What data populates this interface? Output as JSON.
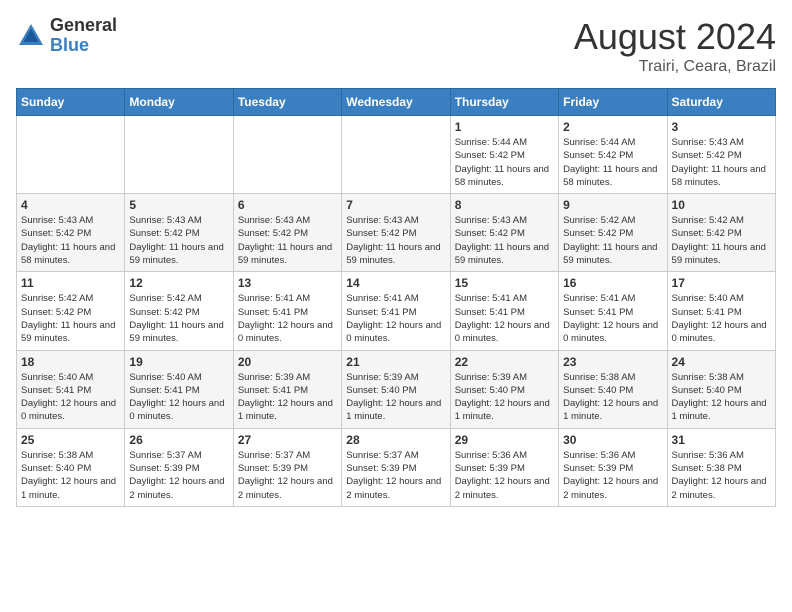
{
  "logo": {
    "general": "General",
    "blue": "Blue"
  },
  "header": {
    "month": "August 2024",
    "location": "Trairi, Ceara, Brazil"
  },
  "weekdays": [
    "Sunday",
    "Monday",
    "Tuesday",
    "Wednesday",
    "Thursday",
    "Friday",
    "Saturday"
  ],
  "weeks": [
    [
      {
        "day": "",
        "info": ""
      },
      {
        "day": "",
        "info": ""
      },
      {
        "day": "",
        "info": ""
      },
      {
        "day": "",
        "info": ""
      },
      {
        "day": "1",
        "info": "Sunrise: 5:44 AM\nSunset: 5:42 PM\nDaylight: 11 hours and 58 minutes."
      },
      {
        "day": "2",
        "info": "Sunrise: 5:44 AM\nSunset: 5:42 PM\nDaylight: 11 hours and 58 minutes."
      },
      {
        "day": "3",
        "info": "Sunrise: 5:43 AM\nSunset: 5:42 PM\nDaylight: 11 hours and 58 minutes."
      }
    ],
    [
      {
        "day": "4",
        "info": "Sunrise: 5:43 AM\nSunset: 5:42 PM\nDaylight: 11 hours and 58 minutes."
      },
      {
        "day": "5",
        "info": "Sunrise: 5:43 AM\nSunset: 5:42 PM\nDaylight: 11 hours and 59 minutes."
      },
      {
        "day": "6",
        "info": "Sunrise: 5:43 AM\nSunset: 5:42 PM\nDaylight: 11 hours and 59 minutes."
      },
      {
        "day": "7",
        "info": "Sunrise: 5:43 AM\nSunset: 5:42 PM\nDaylight: 11 hours and 59 minutes."
      },
      {
        "day": "8",
        "info": "Sunrise: 5:43 AM\nSunset: 5:42 PM\nDaylight: 11 hours and 59 minutes."
      },
      {
        "day": "9",
        "info": "Sunrise: 5:42 AM\nSunset: 5:42 PM\nDaylight: 11 hours and 59 minutes."
      },
      {
        "day": "10",
        "info": "Sunrise: 5:42 AM\nSunset: 5:42 PM\nDaylight: 11 hours and 59 minutes."
      }
    ],
    [
      {
        "day": "11",
        "info": "Sunrise: 5:42 AM\nSunset: 5:42 PM\nDaylight: 11 hours and 59 minutes."
      },
      {
        "day": "12",
        "info": "Sunrise: 5:42 AM\nSunset: 5:42 PM\nDaylight: 11 hours and 59 minutes."
      },
      {
        "day": "13",
        "info": "Sunrise: 5:41 AM\nSunset: 5:41 PM\nDaylight: 12 hours and 0 minutes."
      },
      {
        "day": "14",
        "info": "Sunrise: 5:41 AM\nSunset: 5:41 PM\nDaylight: 12 hours and 0 minutes."
      },
      {
        "day": "15",
        "info": "Sunrise: 5:41 AM\nSunset: 5:41 PM\nDaylight: 12 hours and 0 minutes."
      },
      {
        "day": "16",
        "info": "Sunrise: 5:41 AM\nSunset: 5:41 PM\nDaylight: 12 hours and 0 minutes."
      },
      {
        "day": "17",
        "info": "Sunrise: 5:40 AM\nSunset: 5:41 PM\nDaylight: 12 hours and 0 minutes."
      }
    ],
    [
      {
        "day": "18",
        "info": "Sunrise: 5:40 AM\nSunset: 5:41 PM\nDaylight: 12 hours and 0 minutes."
      },
      {
        "day": "19",
        "info": "Sunrise: 5:40 AM\nSunset: 5:41 PM\nDaylight: 12 hours and 0 minutes."
      },
      {
        "day": "20",
        "info": "Sunrise: 5:39 AM\nSunset: 5:41 PM\nDaylight: 12 hours and 1 minute."
      },
      {
        "day": "21",
        "info": "Sunrise: 5:39 AM\nSunset: 5:40 PM\nDaylight: 12 hours and 1 minute."
      },
      {
        "day": "22",
        "info": "Sunrise: 5:39 AM\nSunset: 5:40 PM\nDaylight: 12 hours and 1 minute."
      },
      {
        "day": "23",
        "info": "Sunrise: 5:38 AM\nSunset: 5:40 PM\nDaylight: 12 hours and 1 minute."
      },
      {
        "day": "24",
        "info": "Sunrise: 5:38 AM\nSunset: 5:40 PM\nDaylight: 12 hours and 1 minute."
      }
    ],
    [
      {
        "day": "25",
        "info": "Sunrise: 5:38 AM\nSunset: 5:40 PM\nDaylight: 12 hours and 1 minute."
      },
      {
        "day": "26",
        "info": "Sunrise: 5:37 AM\nSunset: 5:39 PM\nDaylight: 12 hours and 2 minutes."
      },
      {
        "day": "27",
        "info": "Sunrise: 5:37 AM\nSunset: 5:39 PM\nDaylight: 12 hours and 2 minutes."
      },
      {
        "day": "28",
        "info": "Sunrise: 5:37 AM\nSunset: 5:39 PM\nDaylight: 12 hours and 2 minutes."
      },
      {
        "day": "29",
        "info": "Sunrise: 5:36 AM\nSunset: 5:39 PM\nDaylight: 12 hours and 2 minutes."
      },
      {
        "day": "30",
        "info": "Sunrise: 5:36 AM\nSunset: 5:39 PM\nDaylight: 12 hours and 2 minutes."
      },
      {
        "day": "31",
        "info": "Sunrise: 5:36 AM\nSunset: 5:38 PM\nDaylight: 12 hours and 2 minutes."
      }
    ]
  ]
}
